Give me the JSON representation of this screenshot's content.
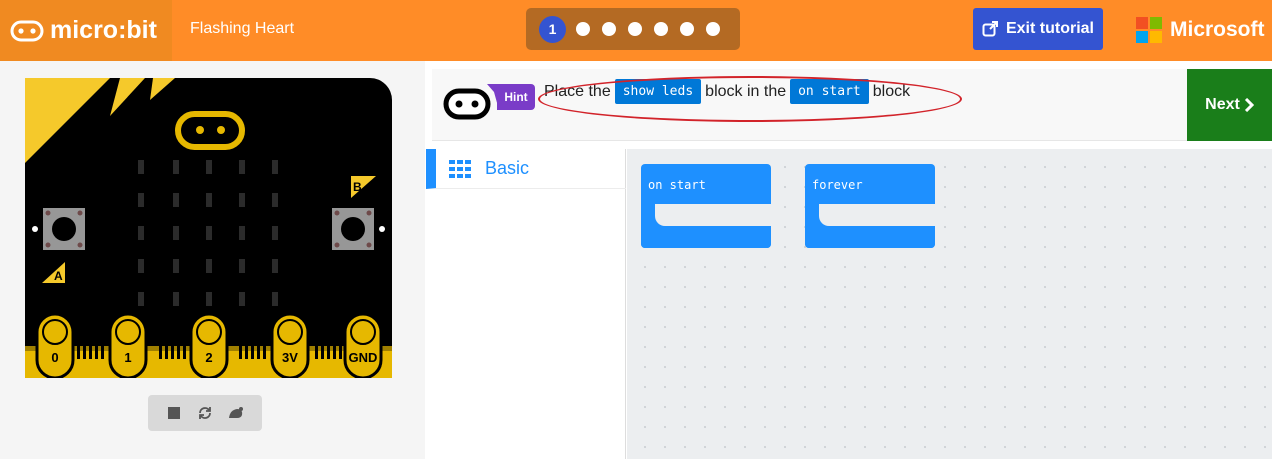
{
  "header": {
    "logo_text": "micro:bit",
    "project_name": "Flashing Heart",
    "steps": {
      "current": "1",
      "total_dots": 7
    },
    "exit_label": "Exit tutorial",
    "brand": "Microsoft"
  },
  "colors": {
    "header_orange": "#ff8c27",
    "accent_blue": "#3454d1",
    "block_blue": "#1e90ff",
    "next_green": "#1a7e1a",
    "hint_purple": "#7a3cc8",
    "board_black": "#000000",
    "board_gold": "#e6b800"
  },
  "hint": {
    "badge": "Hint",
    "text_prefix": "Place the",
    "chip_1": "show leds",
    "text_mid": "block in the",
    "chip_2": "on start",
    "text_suffix": "block"
  },
  "next_label": "Next",
  "toolbox": {
    "items": [
      {
        "label": "Basic",
        "icon": "grid-icon"
      }
    ]
  },
  "workspace": {
    "blocks": [
      {
        "label": "on start"
      },
      {
        "label": "forever"
      }
    ]
  },
  "simulator": {
    "buttons": {
      "a": "A",
      "b": "B"
    },
    "pins": [
      "0",
      "1",
      "2",
      "3V",
      "GND"
    ],
    "controls": [
      "stop-icon",
      "restart-icon",
      "slow-motion-icon"
    ]
  }
}
